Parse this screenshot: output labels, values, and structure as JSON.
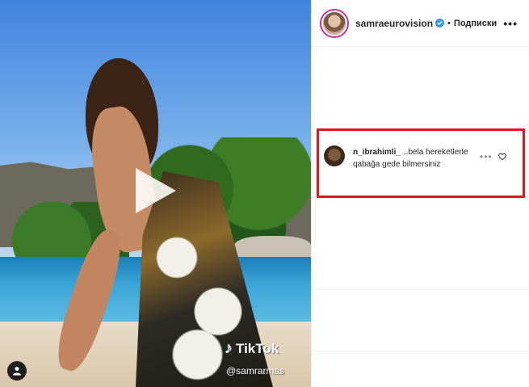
{
  "media": {
    "watermark_brand": "TikTok",
    "watermark_user": "@samrarmas"
  },
  "header": {
    "username": "samraeurovision",
    "separator": "•",
    "follow_label": "Подписки",
    "more_label": "•••"
  },
  "comment": {
    "username": "n_ibrahimli_",
    "text": "..bela hereketlerle qabağa gede bilmersiniz",
    "more_label": "•••"
  },
  "colors": {
    "highlight_border": "#e0161f",
    "verified": "#3897f0"
  }
}
